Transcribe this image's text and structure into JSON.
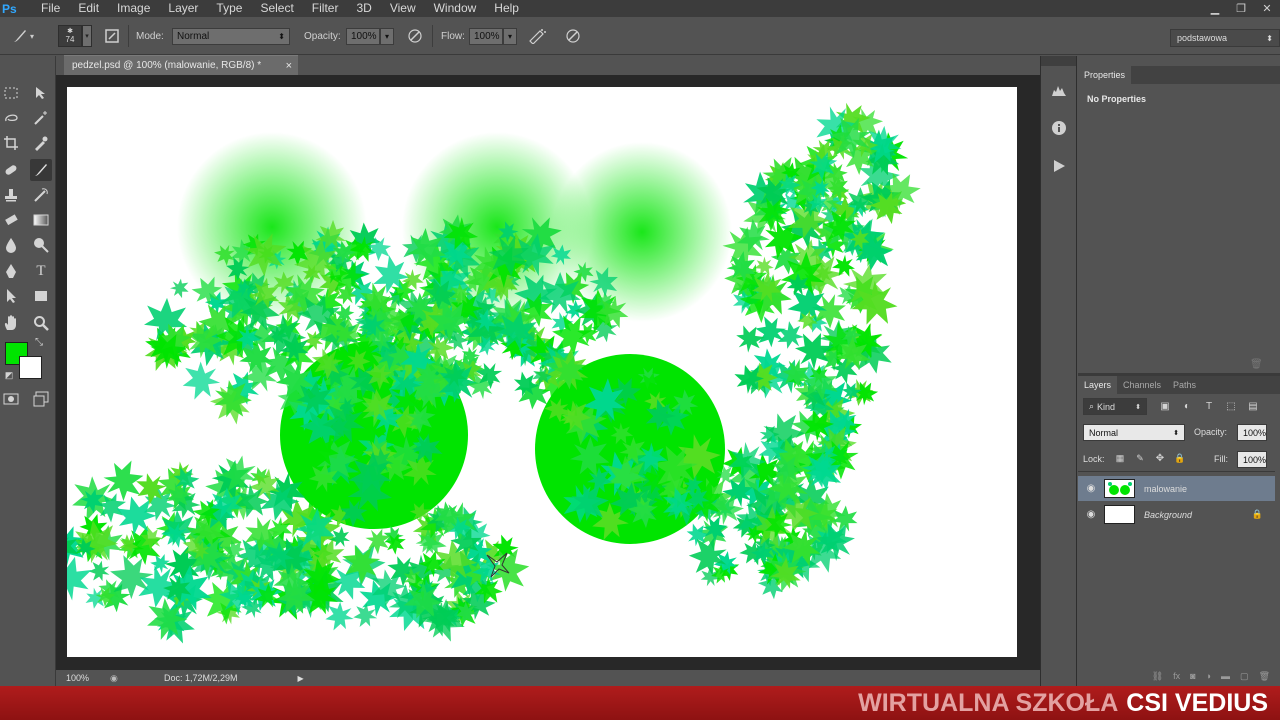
{
  "app": {
    "logo": "Ps"
  },
  "menu": [
    "File",
    "Edit",
    "Image",
    "Layer",
    "Type",
    "Select",
    "Filter",
    "3D",
    "View",
    "Window",
    "Help"
  ],
  "options": {
    "brush_size": "74",
    "mode_label": "Mode:",
    "mode_value": "Normal",
    "opacity_label": "Opacity:",
    "opacity_value": "100%",
    "flow_label": "Flow:",
    "flow_value": "100%"
  },
  "workspace": "podstawowa",
  "document": {
    "tab_title": "pedzel.psd @ 100% (malowanie, RGB/8) *",
    "close_glyph": "×"
  },
  "status": {
    "zoom": "100%",
    "doc_info": "Doc: 1,72M/2,29M"
  },
  "properties": {
    "tab": "Properties",
    "message": "No Properties"
  },
  "layers_panel": {
    "tabs": [
      "Layers",
      "Channels",
      "Paths"
    ],
    "filter_kind": "Kind",
    "blend_mode": "Normal",
    "opacity_label": "Opacity:",
    "opacity_value": "100%",
    "lock_label": "Lock:",
    "fill_label": "Fill:",
    "fill_value": "100%",
    "layers": [
      {
        "name": "malowanie",
        "selected": true
      },
      {
        "name": "Background",
        "selected": false
      }
    ]
  },
  "colors": {
    "foreground": "#00e400",
    "background": "#ffffff",
    "accent_green": "#00e400"
  },
  "banner": {
    "school": "WIRTUALNA SZKOŁA",
    "brand": "CSI VEDIUS"
  }
}
